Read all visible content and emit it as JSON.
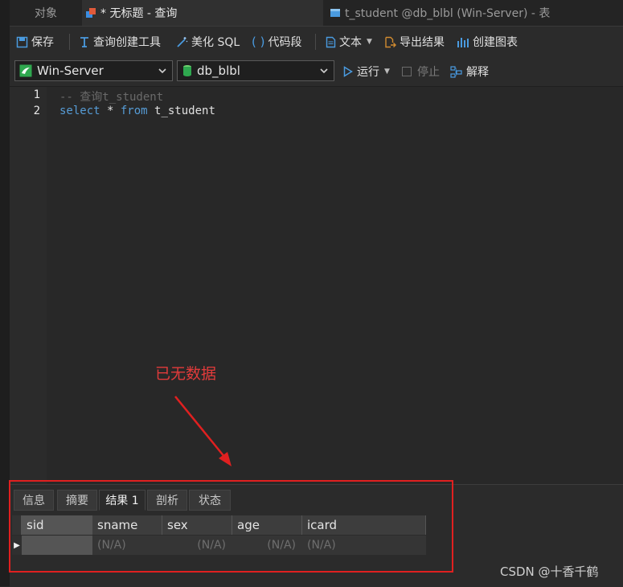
{
  "tabs": [
    {
      "label": "对象",
      "active": false
    },
    {
      "label": "* 无标题 - 查询",
      "active": true
    },
    {
      "label": "t_student @db_blbl (Win-Server) - 表",
      "active": false
    }
  ],
  "toolbar": {
    "save": "保存",
    "query_builder": "查询创建工具",
    "beautify": "美化 SQL",
    "snippet": "代码段",
    "text": "文本",
    "export": "导出结果",
    "chart": "创建图表"
  },
  "connection": {
    "server": "Win-Server",
    "database": "db_blbl",
    "run": "运行",
    "stop": "停止",
    "explain": "解释"
  },
  "editor": {
    "line_numbers": [
      "1",
      "2"
    ],
    "line1": "-- 查询t_student",
    "line2_kw1": "select",
    "line2_mid": " * ",
    "line2_kw2": "from",
    "line2_tail": " t_student"
  },
  "annotation": "已无数据",
  "result_tabs": [
    "信息",
    "摘要",
    "结果 1",
    "剖析",
    "状态"
  ],
  "result_grid": {
    "columns": [
      "sid",
      "sname",
      "sex",
      "age",
      "icard"
    ],
    "row": [
      "",
      "(N/A)",
      "(N/A)",
      "(N/A)",
      "(N/A)"
    ]
  },
  "watermark": "CSDN @十香千鹤",
  "colors": {
    "annotation": "#e23b3b",
    "keyword": "#569cd6"
  }
}
